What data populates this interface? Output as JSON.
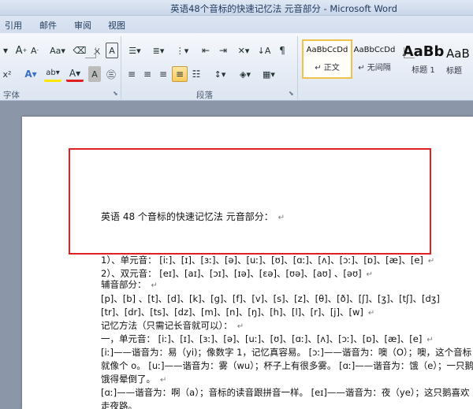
{
  "window": {
    "title": "英语48个音标的快速记忆法 元音部分 - Microsoft Word"
  },
  "tabs": [
    "引用",
    "邮件",
    "审阅",
    "视图"
  ],
  "ribbon": {
    "font_group_label": "字体",
    "paragraph_group_label": "段落",
    "styles": [
      {
        "preview": "AaBbCcDd",
        "name": "↵ 正文"
      },
      {
        "preview": "AaBbCcDd",
        "name": "↵ 无间隔"
      },
      {
        "preview": "AaBb",
        "name": "标题 1"
      },
      {
        "preview": "AaB",
        "name": "标题"
      }
    ]
  },
  "document": {
    "heading": "英语 48 个音标的快速记忆法 元音部分：",
    "para_mark": "↵",
    "lines": [
      "1）、单元音：  [iː]、[ɪ]、[ɜː]、[ə]、[uː]、[ʊ]、[ɑː]、[ʌ]、[ɔː]、[ɒ]、[æ]、[e]",
      "2）、双元音：  [eɪ]、[aɪ]、[ɔɪ]、[ɪə]、[ɛə]、[ʊə]、[aʊ]  、[əʊ]",
      "辅音部分：",
      "[p]、[b]  、[t]、[d]、[k]、[g]、[f]、[v]、[s]、[z]、[θ]、[ð]、[ʃ]、[ʒ]、[tʃ]、[dʒ]",
      "[tr]、[dr]、[ts]、[dz]、[m]、[n]、[ŋ]、[h]、[l]、[r]、[j]、[w]",
      "记忆方法（只需记长音就可以）：",
      "一，单元音：  [iː]、[ɪ]、[ɜː]、[ə]、[uː]、[ʊ]、[ɑː]、[ʌ]、[ɔː]、[ɒ]、[æ]、[e]",
      "[iː]——谐音为：易（yi)；像数字 1，记忆真容易。   [ɔː]——谐音为：噢（O）；噢，这个音标",
      "就像个 o。  [uː]——谐音为：雾（wu）；杯子上有很多雾。   [ɑː]——谐音为：饿（e）；一只鹅",
      "饿得晕倒了。",
      "[ɑː]——谐音为：啊（a）；音标的读音跟拼音一样。   [eɪ]——谐音为：夜（ye）；这只鹅喜欢",
      "走夜路。"
    ]
  }
}
